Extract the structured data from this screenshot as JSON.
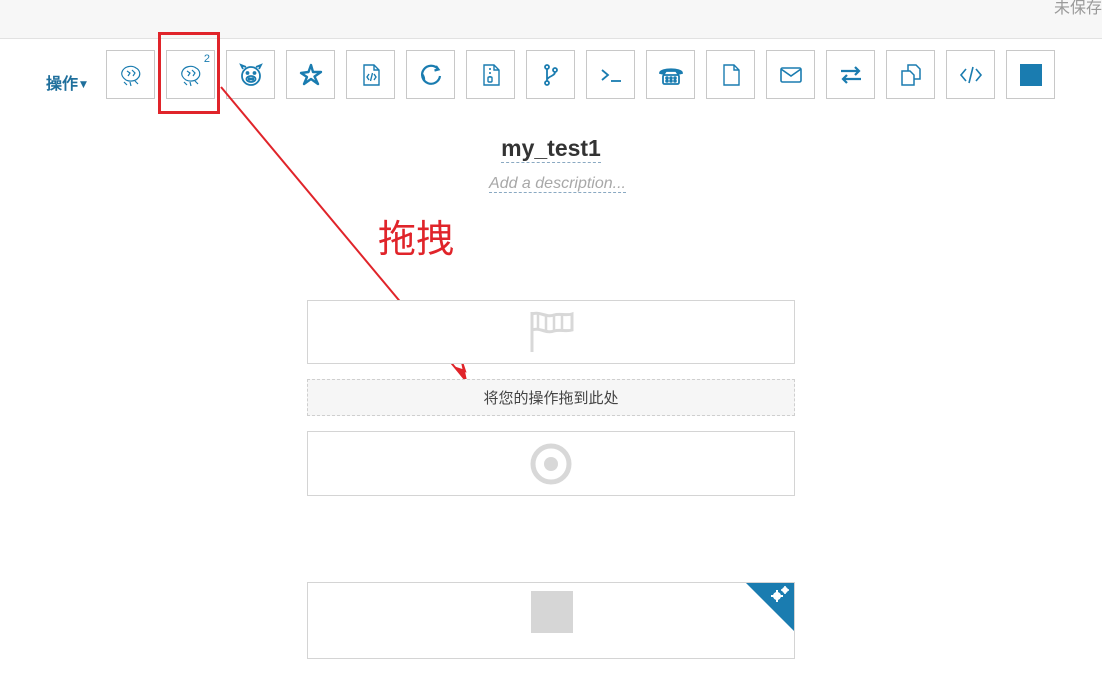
{
  "topbar": {
    "status_text": "未保存"
  },
  "toolbar": {
    "actions_label": "操作",
    "tools": [
      {
        "icon": "hive-icon",
        "badge": ""
      },
      {
        "icon": "hive2-icon",
        "badge": "2"
      },
      {
        "icon": "pig-icon",
        "badge": ""
      },
      {
        "icon": "spark-icon",
        "badge": ""
      },
      {
        "icon": "java-file-icon",
        "badge": ""
      },
      {
        "icon": "sqoop-icon",
        "badge": ""
      },
      {
        "icon": "mapreduce-jar-icon",
        "badge": ""
      },
      {
        "icon": "subworkflow-icon",
        "badge": ""
      },
      {
        "icon": "shell-icon",
        "badge": ""
      },
      {
        "icon": "ssh-icon",
        "badge": ""
      },
      {
        "icon": "hdfs-file-icon",
        "badge": ""
      },
      {
        "icon": "email-icon",
        "badge": ""
      },
      {
        "icon": "streaming-icon",
        "badge": ""
      },
      {
        "icon": "distcp-icon",
        "badge": ""
      },
      {
        "icon": "generic-code-icon",
        "badge": ""
      },
      {
        "icon": "kill-node-icon",
        "badge": ""
      }
    ]
  },
  "annotation": {
    "drag_note": "拖拽",
    "color": "#e0242a"
  },
  "workflow": {
    "name": "my_test1",
    "description_placeholder": "Add a description...",
    "drop_zone_text": "将您的操作拖到此处"
  },
  "colors": {
    "accent": "#1a7cb0",
    "node_border": "#d4d4d4",
    "muted_icon": "#d6d6d6"
  }
}
